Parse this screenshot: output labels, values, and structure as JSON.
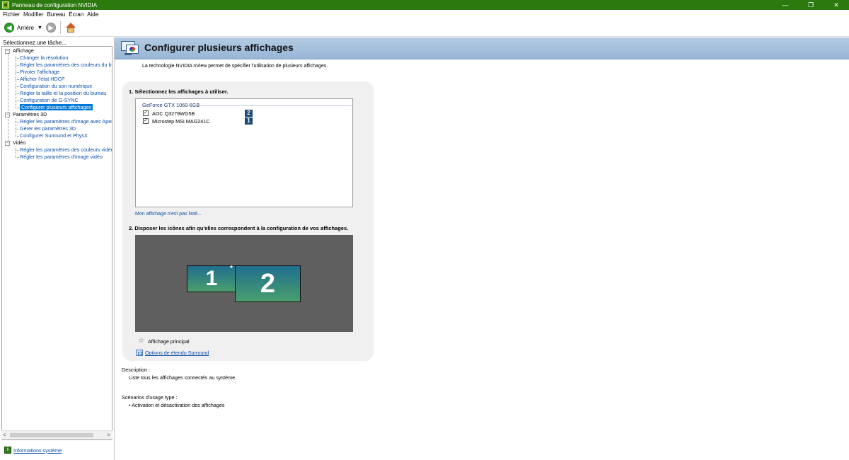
{
  "window": {
    "title": "Panneau de configuration NVIDIA",
    "minimize": "—",
    "restore": "❐",
    "close": "✕"
  },
  "menu": [
    "Fichier",
    "Modifier",
    "Bureau",
    "Écran",
    "Aide"
  ],
  "toolbar": {
    "back_label": "Arrière",
    "dropdown": "▼"
  },
  "sidebar": {
    "title": "Sélectionnez une tâche...",
    "categories": [
      {
        "label": "Affichage",
        "toggle": "−",
        "items": [
          "Changer la résolution",
          "Régler les paramètres des couleurs du bure",
          "Pivoter l'affichage",
          "Afficher l'état HDCP",
          "Configuration du son numérique",
          "Régler la taille et la position du bureau",
          "Configuration de G-SYNC",
          "Configurer plusieurs affichages"
        ]
      },
      {
        "label": "Paramètres 3D",
        "toggle": "−",
        "items": [
          "Régler les paramètres d'image avec Aperçu",
          "Gérer les paramètres 3D",
          "Configurer Surround et PhysX"
        ]
      },
      {
        "label": "Vidéo",
        "toggle": "−",
        "items": [
          "Régler les paramètres des couleurs vidéo",
          "Régler les paramètres d'image vidéo"
        ]
      }
    ],
    "selected_item": "Configurer plusieurs affichages",
    "scroll_left": "<",
    "scroll_right": ">",
    "system_info": "Informations système"
  },
  "page": {
    "title": "Configurer plusieurs affichages",
    "intro": "La technologie NVIDIA nView permet de spécifier l'utilisation de plusieurs affichages.",
    "step1": "1. Sélectionnez les affichages à utiliser.",
    "gpu": "GeForce GTX 1060 6GB",
    "displays": [
      {
        "name": "AOC Q3279WG5B",
        "checked": "✓",
        "number": "2"
      },
      {
        "name": "Microstep MSI MAG241C",
        "checked": "✓",
        "number": "1"
      }
    ],
    "not_listed": "Mon affichage n'est pas listé...",
    "step2": "2. Disposer les icônes afin qu'elles correspondent à la configuration de vos affichages.",
    "monitor1": "1",
    "monitor2": "2",
    "primary_marker": "*",
    "primary_label": "Affichage principal",
    "surround_link": "Options de étendu Surround",
    "description_label": "Description :",
    "description_text": "Liste tous les affichages connectés au système.",
    "usage_label": "Scénarios d'usage type :",
    "usage_item": "• Activation et désactivation des affichages"
  },
  "colors": {
    "titlebar": "#2c7a0f",
    "banner": "#b4cbe3",
    "selection": "#0078d7",
    "link": "#0b4fa8",
    "badge": "#1d4a72"
  }
}
